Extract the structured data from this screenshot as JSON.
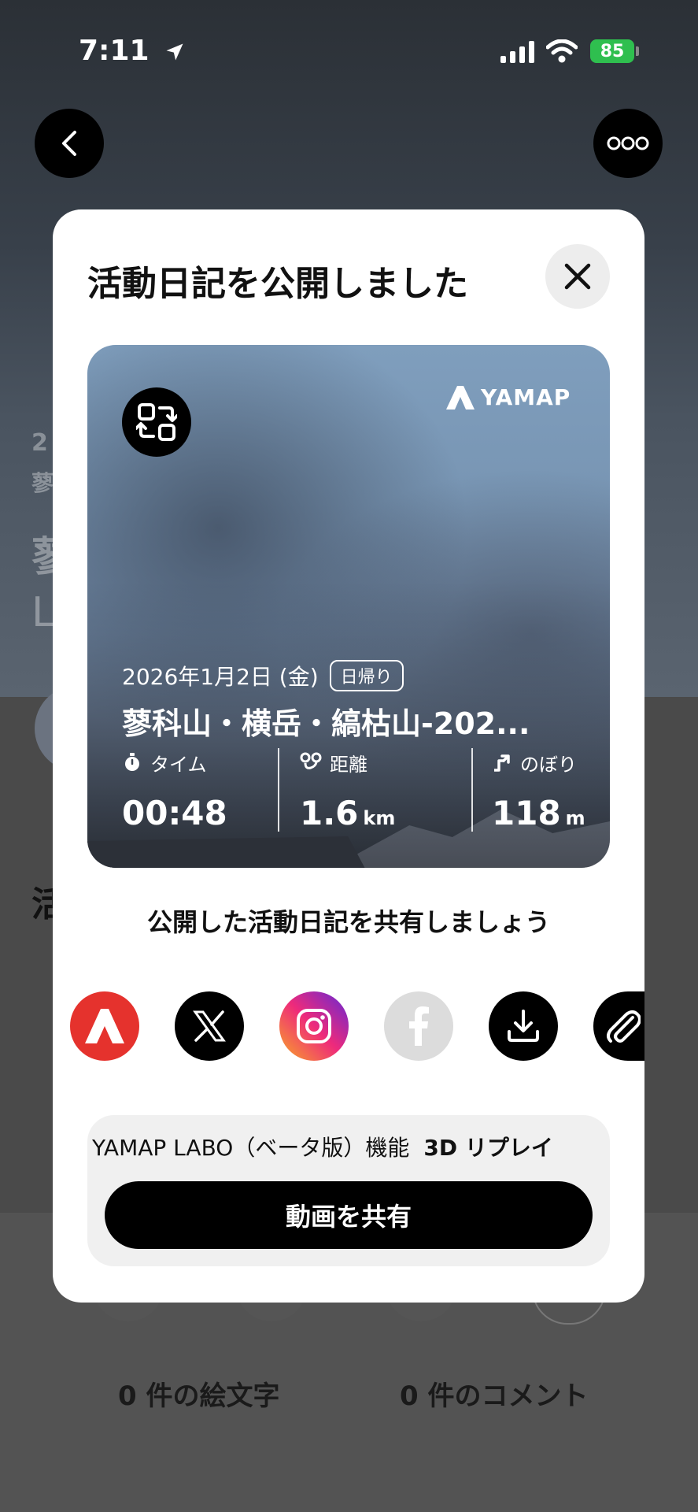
{
  "status_bar": {
    "time": "7:11",
    "battery": "85"
  },
  "background_page": {
    "date_fragment": "2",
    "title_fragment_1": "蓼",
    "title_fragment_2": "蓼",
    "title_fragment_3": "L",
    "section_fragment": "活",
    "reactions_count": "0 件の絵文字",
    "comments_count": "0 件のコメント"
  },
  "modal": {
    "title": "活動日記を公開しました",
    "card": {
      "brand": "YAMAP",
      "date": "2026年1月2日 (金)",
      "trip_type": "日帰り",
      "mountain_title": "蓼科山・横岳・縞枯山-202...",
      "stats": [
        {
          "label": "タイム",
          "value": "00:48",
          "unit": ""
        },
        {
          "label": "距離",
          "value": "1.6",
          "unit": "km"
        },
        {
          "label": "のぼり",
          "value": "118",
          "unit": "m"
        }
      ]
    },
    "share_prompt": "公開した活動日記を共有しましょう",
    "share_targets": [
      "yamap-icon",
      "x-icon",
      "instagram-icon",
      "facebook-icon",
      "download-icon",
      "attachment-icon"
    ],
    "labo": {
      "label": "YAMAP LABO（ベータ版）機能",
      "feature": "3D リプレイ",
      "button": "動画を共有"
    }
  },
  "colors": {
    "yamap_red": "#e5322d",
    "facebook_disabled": "#dcdcdc",
    "battery_green": "#2fbf4f"
  }
}
